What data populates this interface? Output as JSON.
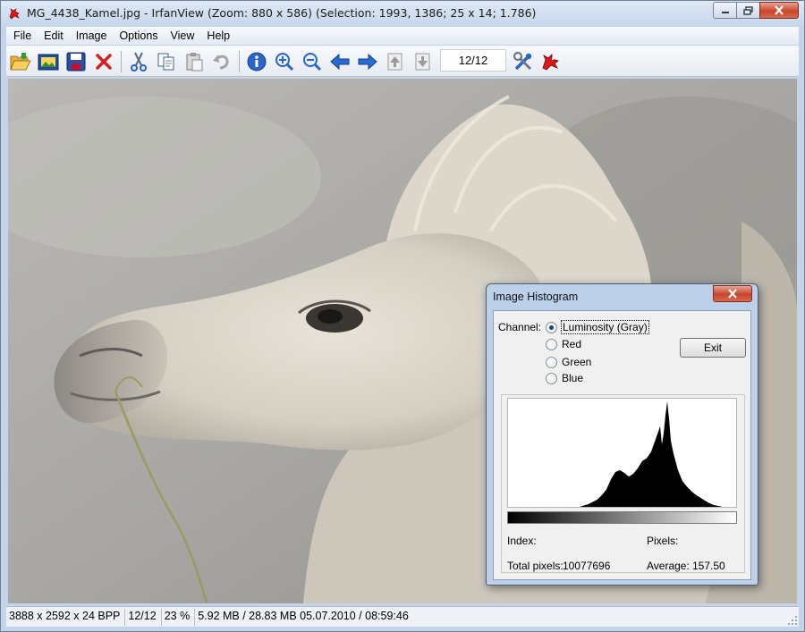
{
  "window": {
    "title": "MG_4438_Kamel.jpg - IrfanView (Zoom: 880 x 586) (Selection: 1993, 1386; 25 x 14; 1.786)"
  },
  "menu": {
    "items": [
      "File",
      "Edit",
      "Image",
      "Options",
      "View",
      "Help"
    ]
  },
  "toolbar": {
    "buttons": [
      {
        "name": "open-icon",
        "tooltip": "Open"
      },
      {
        "name": "slideshow-icon",
        "tooltip": "Slideshow"
      },
      {
        "name": "save-icon",
        "tooltip": "Save"
      },
      {
        "name": "delete-icon",
        "tooltip": "Delete"
      },
      {
        "name": "cut-icon",
        "tooltip": "Cut"
      },
      {
        "name": "copy-icon",
        "tooltip": "Copy"
      },
      {
        "name": "paste-icon",
        "tooltip": "Paste"
      },
      {
        "name": "undo-icon",
        "tooltip": "Undo"
      },
      {
        "name": "info-icon",
        "tooltip": "Image info"
      },
      {
        "name": "zoom-in-icon",
        "tooltip": "Zoom in"
      },
      {
        "name": "zoom-out-icon",
        "tooltip": "Zoom out"
      },
      {
        "name": "previous-icon",
        "tooltip": "Previous"
      },
      {
        "name": "next-icon",
        "tooltip": "Next"
      },
      {
        "name": "first-file-icon",
        "tooltip": "First"
      },
      {
        "name": "last-file-icon",
        "tooltip": "Last"
      },
      {
        "name": "settings-icon",
        "tooltip": "Options"
      },
      {
        "name": "irfanview-logo-icon",
        "tooltip": "About"
      }
    ],
    "page_counter": "12/12"
  },
  "status": {
    "dimensions": "3888 x 2592 x 24 BPP",
    "page": "12/12",
    "zoom": "23 %",
    "size_date": "5.92 MB / 28.83 MB 05.07.2010 / 08:59:46"
  },
  "histogram_dialog": {
    "title": "Image Histogram",
    "channel_label": "Channel:",
    "channels": [
      "Luminosity (Gray)",
      "Red",
      "Green",
      "Blue"
    ],
    "selected_channel": "Luminosity (Gray)",
    "exit_label": "Exit",
    "index_label": "Index:",
    "pixels_label": "Pixels:",
    "total_pixels_label": "Total pixels:",
    "total_pixels_value": "10077696",
    "average_label": "Average:",
    "average_value": "157.50"
  },
  "chart_data": {
    "type": "area",
    "title": "",
    "xlim": [
      0,
      255
    ],
    "x": [
      0,
      80,
      90,
      100,
      105,
      110,
      115,
      120,
      125,
      130,
      135,
      140,
      145,
      150,
      155,
      160,
      165,
      168,
      170,
      172,
      174,
      176,
      178,
      180,
      182,
      185,
      190,
      195,
      200,
      205,
      210,
      215,
      220,
      225,
      230,
      235,
      240,
      255
    ],
    "y": [
      0,
      0,
      3,
      8,
      13,
      19,
      30,
      38,
      40,
      37,
      33,
      36,
      42,
      50,
      53,
      60,
      74,
      82,
      88,
      68,
      80,
      100,
      115,
      96,
      72,
      58,
      40,
      28,
      22,
      17,
      13,
      10,
      7,
      4,
      2,
      1,
      0,
      0
    ]
  }
}
